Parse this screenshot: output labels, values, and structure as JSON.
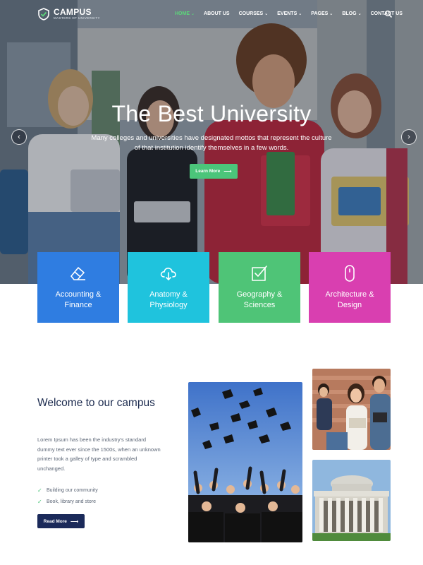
{
  "nav": {
    "logo_title": "CAMPUS",
    "logo_subtitle": "MASTERS OF UNIVERSITY",
    "items": [
      {
        "label": "HOME",
        "active": true,
        "dropdown": true
      },
      {
        "label": "ABOUT US",
        "active": false,
        "dropdown": false
      },
      {
        "label": "COURSES",
        "active": false,
        "dropdown": true
      },
      {
        "label": "EVENTS",
        "active": false,
        "dropdown": true
      },
      {
        "label": "PAGES",
        "active": false,
        "dropdown": true
      },
      {
        "label": "BLOG",
        "active": false,
        "dropdown": true
      },
      {
        "label": "CONTACT US",
        "active": false,
        "dropdown": false
      }
    ],
    "chevron": "⌄",
    "search_icon": "search-icon"
  },
  "hero": {
    "title": "The Best University",
    "subtitle": "Many colleges and universities have designated mottos that represent the culture of that institution identify themselves in a few words.",
    "button_label": "Learn More",
    "arrow": "⟶",
    "prev": "‹",
    "next": "›"
  },
  "cards": [
    {
      "line1": "Accounting &",
      "line2": "Finance",
      "color": "#2f7de1",
      "icon": "eraser-icon"
    },
    {
      "line1": "Anatomy &",
      "line2": "Physiology",
      "color": "#1fc3dd",
      "icon": "cloud-download-icon"
    },
    {
      "line1": "Geography &",
      "line2": "Sciences",
      "color": "#4fc477",
      "icon": "checkbox-icon"
    },
    {
      "line1": "Architecture &",
      "line2": "Design",
      "color": "#d93fb0",
      "icon": "mouse-icon"
    }
  ],
  "welcome": {
    "title": "Welcome to our campus",
    "text": "Lorem Ipsum has been the industry's standard dummy text ever since the 1500s, when an unknown printer took a galley of type and scrambled unchanged.",
    "checks": [
      "Building our community",
      "Book, library and store"
    ],
    "check_mark": "✓",
    "button_label": "Read More",
    "arrow": "⟶"
  },
  "colors": {
    "accent_green": "#4bc57a",
    "navy": "#1b2a5a",
    "active_nav": "#5cd67a"
  }
}
